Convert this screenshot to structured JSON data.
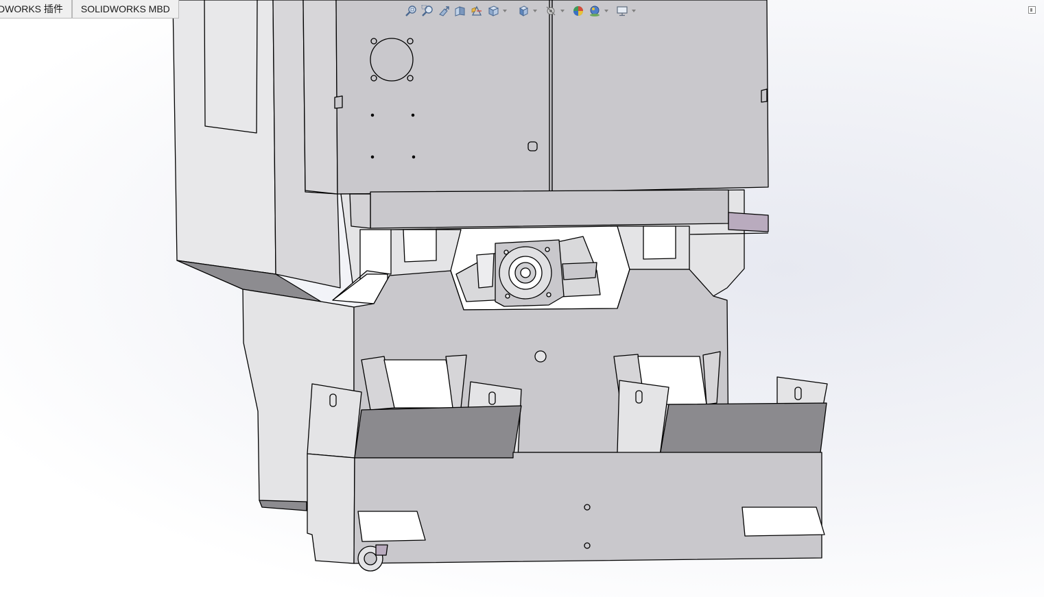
{
  "tabs": [
    {
      "label": "DWORKS 插件"
    },
    {
      "label": "SOLIDWORKS MBD"
    }
  ],
  "heads_up_toolbar": {
    "buttons": [
      {
        "icon": "zoom-to-fit-icon"
      },
      {
        "icon": "zoom-to-area-icon"
      },
      {
        "icon": "previous-view-icon"
      },
      {
        "icon": "section-view-icon"
      },
      {
        "icon": "dynamic-annotation-views-icon"
      },
      {
        "icon": "view-orientation-icon",
        "dropdown": true
      },
      {
        "icon": "display-style-icon",
        "dropdown": true
      },
      {
        "icon": "hide-show-items-icon",
        "dropdown": true
      },
      {
        "icon": "edit-appearance-icon"
      },
      {
        "icon": "apply-scene-icon",
        "dropdown": true
      },
      {
        "icon": "view-setting-icon",
        "dropdown": true
      }
    ]
  },
  "colors": {
    "viewport_bg_center": "#e7e9f1",
    "viewport_bg_edge": "#ffffff",
    "part_light": "#e4e4e6",
    "part_mid": "#c8c7cb",
    "part_dark": "#8b8a8e",
    "edge": "#000000",
    "accent_highlight": "#b9abbe"
  }
}
